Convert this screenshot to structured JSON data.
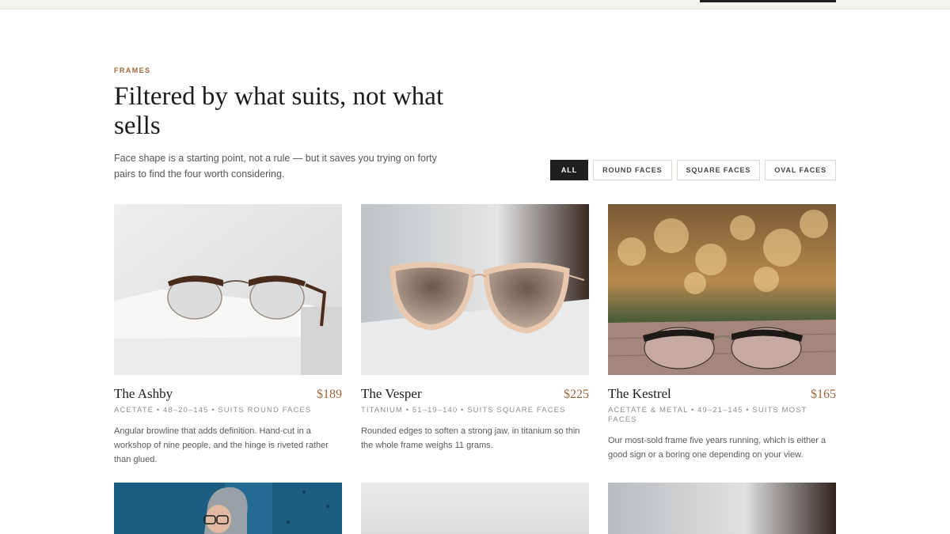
{
  "section": {
    "eyebrow": "FRAMES",
    "title": "Filtered by what suits, not what sells",
    "lede": "Face shape is a starting point, not a rule — but it saves you trying on forty pairs to find the four worth considering."
  },
  "filters": [
    {
      "label": "ALL",
      "active": true
    },
    {
      "label": "ROUND FACES",
      "active": false
    },
    {
      "label": "SQUARE FACES",
      "active": false
    },
    {
      "label": "OVAL FACES",
      "active": false
    }
  ],
  "products": [
    {
      "name": "The Ashby",
      "price": "$189",
      "meta": "ACETATE • 48–20–145 • SUITS ROUND FACES",
      "desc": "Angular browline that adds definition. Hand-cut in a workshop of nine people, and the hinge is riveted rather than glued."
    },
    {
      "name": "The Vesper",
      "price": "$225",
      "meta": "TITANIUM • 51–19–140 • SUITS SQUARE FACES",
      "desc": "Rounded edges to soften a strong jaw, in titanium so thin the whole frame weighs 11 grams."
    },
    {
      "name": "The Kestrel",
      "price": "$165",
      "meta": "ACETATE & METAL • 49–21–145 • SUITS MOST FACES",
      "desc": "Our most-sold frame five years running, which is either a good sign or a boring one depending on your view."
    }
  ],
  "colors": {
    "accent": "#a0633a",
    "active_filter": "#1f1f1f"
  }
}
